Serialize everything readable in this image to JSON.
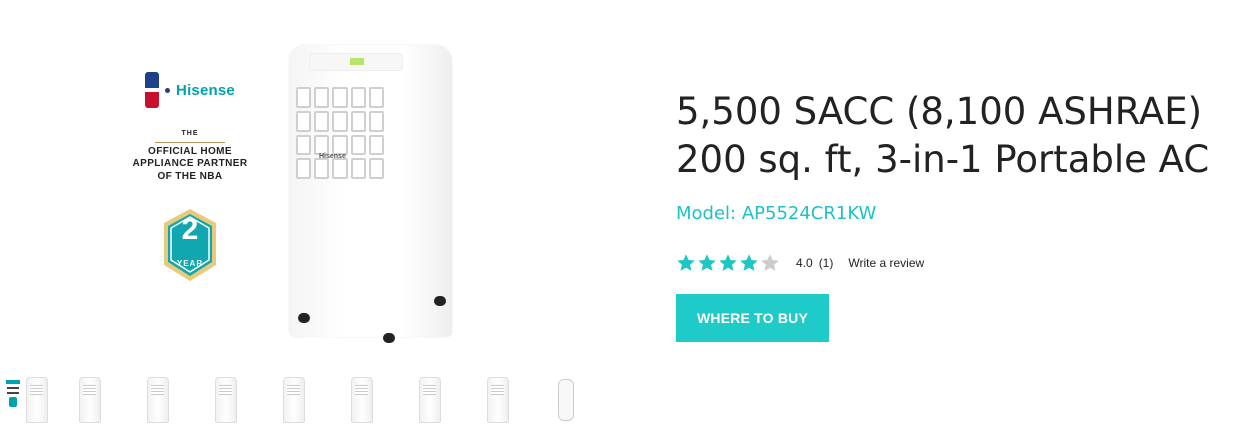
{
  "gallery": {
    "brand": {
      "logo_icon": "nba-logo-icon",
      "name": "Hisense"
    },
    "partner_badge": {
      "the": "THE",
      "line1": "OFFICIAL HOME",
      "line2": "APPLIANCE PARTNER",
      "line3": "OF THE NBA"
    },
    "warranty_badge": {
      "number": "2",
      "label": "YEAR",
      "icon": "shield-icon"
    },
    "main_image": "portable-ac-unit-image",
    "ac_logo": "Hisense",
    "thumbnails": [
      {
        "type": "badge-and-unit",
        "icon": "thumbnail-front-with-badges"
      },
      {
        "type": "unit",
        "icon": "thumbnail-angle"
      },
      {
        "type": "unit",
        "icon": "thumbnail-front"
      },
      {
        "type": "unit",
        "icon": "thumbnail-front-2"
      },
      {
        "type": "unit",
        "icon": "thumbnail-side"
      },
      {
        "type": "unit",
        "icon": "thumbnail-with-hose"
      },
      {
        "type": "unit",
        "icon": "thumbnail-front-3"
      },
      {
        "type": "unit",
        "icon": "thumbnail-back"
      },
      {
        "type": "remote",
        "icon": "thumbnail-remote"
      }
    ]
  },
  "product": {
    "title_line1": "5,500 SACC (8,100 ASHRAE)",
    "title_line2": "200 sq. ft, 3-in-1 Portable AC",
    "model": "Model: AP5524CR1KW",
    "rating": {
      "stars_filled": 4,
      "stars_total": 5,
      "value": "4.0",
      "count": "(1)",
      "write_review": "Write a review"
    },
    "buy_button": "WHERE TO BUY"
  },
  "colors": {
    "accent": "#1ecbc8",
    "model_text": "#1fc1c7",
    "star_filled": "#1fc7c4",
    "star_empty": "#cccccc"
  }
}
